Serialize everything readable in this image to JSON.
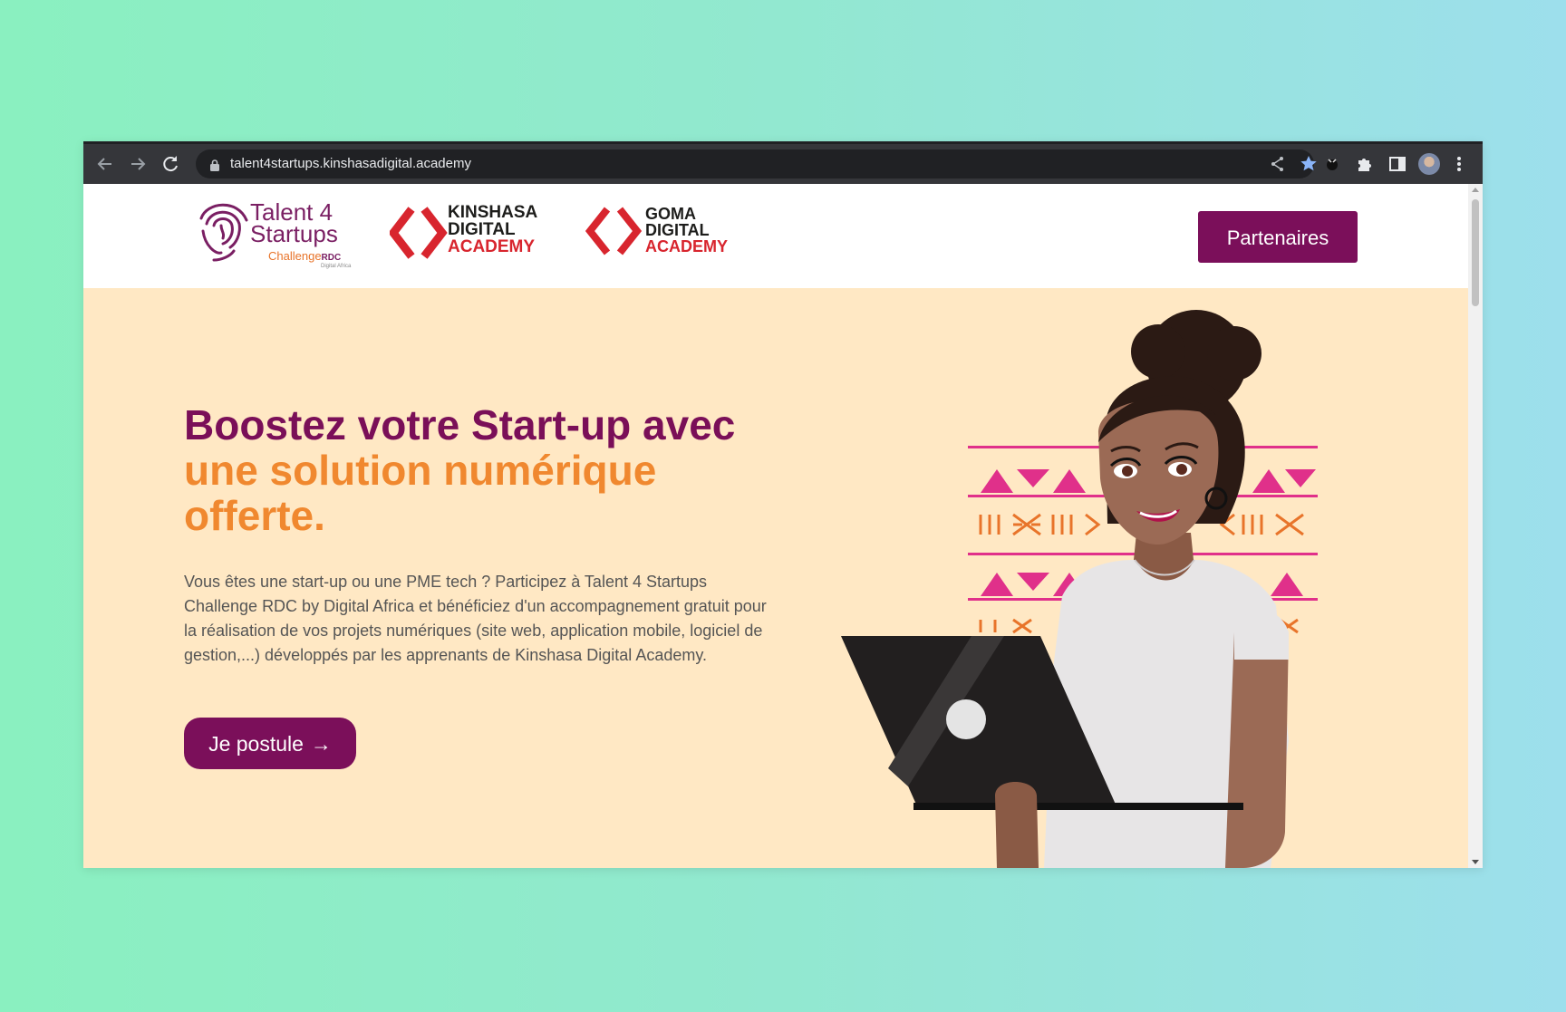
{
  "browser": {
    "url": "talent4startups.kinshasadigital.academy",
    "icons": [
      "back-icon",
      "forward-icon",
      "reload-icon",
      "lock-icon",
      "share-icon",
      "bookmark-star-icon",
      "extension-icon",
      "puzzle-icon",
      "sidepanel-icon",
      "profile-avatar",
      "menu-icon"
    ]
  },
  "header": {
    "logo_t4s": {
      "line1": "Talent 4",
      "line2": "Startups",
      "line3": "Challenge",
      "line3_strong": "RDC",
      "line4": "Digital Africa"
    },
    "logo_kda": {
      "line1": "KINSHASA",
      "line2": "DIGITAL",
      "line3": "ACADEMY"
    },
    "logo_gda": {
      "line1": "GOMA",
      "line2": "DIGITAL",
      "line3": "ACADEMY"
    },
    "partners_button": "Partenaires"
  },
  "hero": {
    "headline_part1": "Boostez votre Start-up avec",
    "headline_part2": "une solution numérique",
    "headline_part3": "offerte.",
    "description": "Vous êtes une start-up ou une PME tech ? Participez à Talent 4 Startups Challenge RDC by Digital Africa et bénéficiez d'un accompagnement gratuit pour la réalisation de vos projets numériques (site web, application mobile, logiciel de gestion,...) développés par les apprenants de Kinshasa Digital Academy.",
    "cta_label": "Je postule",
    "cta_arrow": "→"
  },
  "colors": {
    "plum": "#7b0f5a",
    "orange": "#f0882f",
    "hero_bg": "#ffe8c4",
    "red": "#d8252e",
    "pattern_pink": "#e0308a"
  }
}
